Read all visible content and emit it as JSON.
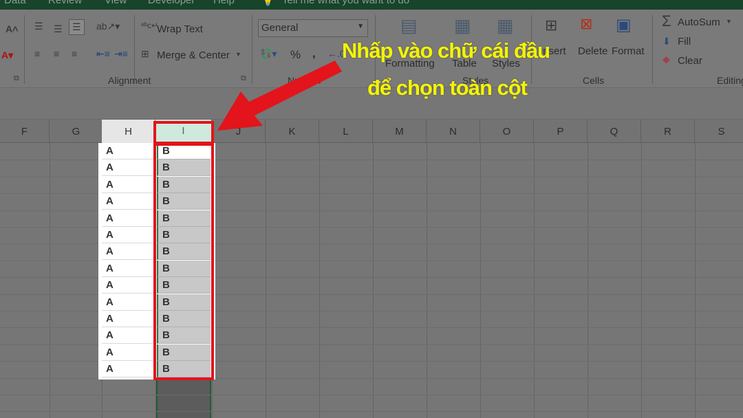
{
  "menu_tabs": [
    "Data",
    "Review",
    "View",
    "Developer",
    "Help"
  ],
  "tell_me": "Tell me what you want to do",
  "ribbon": {
    "alignment": {
      "wrap_text": "Wrap Text",
      "merge_center": "Merge & Center",
      "label": "Alignment"
    },
    "number": {
      "format_value": "General",
      "percent": "%",
      "comma": ",",
      "label": "Number"
    },
    "styles": {
      "conditional_formatting": "Formatting",
      "format_as_table": "Table",
      "cell_styles": "Styles",
      "label": "Styles"
    },
    "cells": {
      "insert": "Insert",
      "delete": "Delete",
      "format": "Format",
      "label": "Cells"
    },
    "editing": {
      "autosum": "AutoSum",
      "fill": "Fill",
      "clear": "Clear",
      "label": "Editing"
    }
  },
  "columns": [
    "F",
    "G",
    "H",
    "I",
    "J",
    "K",
    "L",
    "M",
    "N",
    "O",
    "P",
    "Q",
    "R",
    "S"
  ],
  "selected_column": "I",
  "column_h_values": [
    "A",
    "A",
    "A",
    "A",
    "A",
    "A",
    "A",
    "A",
    "A",
    "A",
    "A",
    "A",
    "A",
    "A"
  ],
  "column_i_values": [
    "B",
    "B",
    "B",
    "B",
    "B",
    "B",
    "B",
    "B",
    "B",
    "B",
    "B",
    "B",
    "B",
    "B"
  ],
  "annotation": {
    "line1": "Nhấp vào chữ cái đầu",
    "line2": "để chọn toàn cột",
    "color": "#f4f400",
    "highlight_color": "#e3141b"
  }
}
